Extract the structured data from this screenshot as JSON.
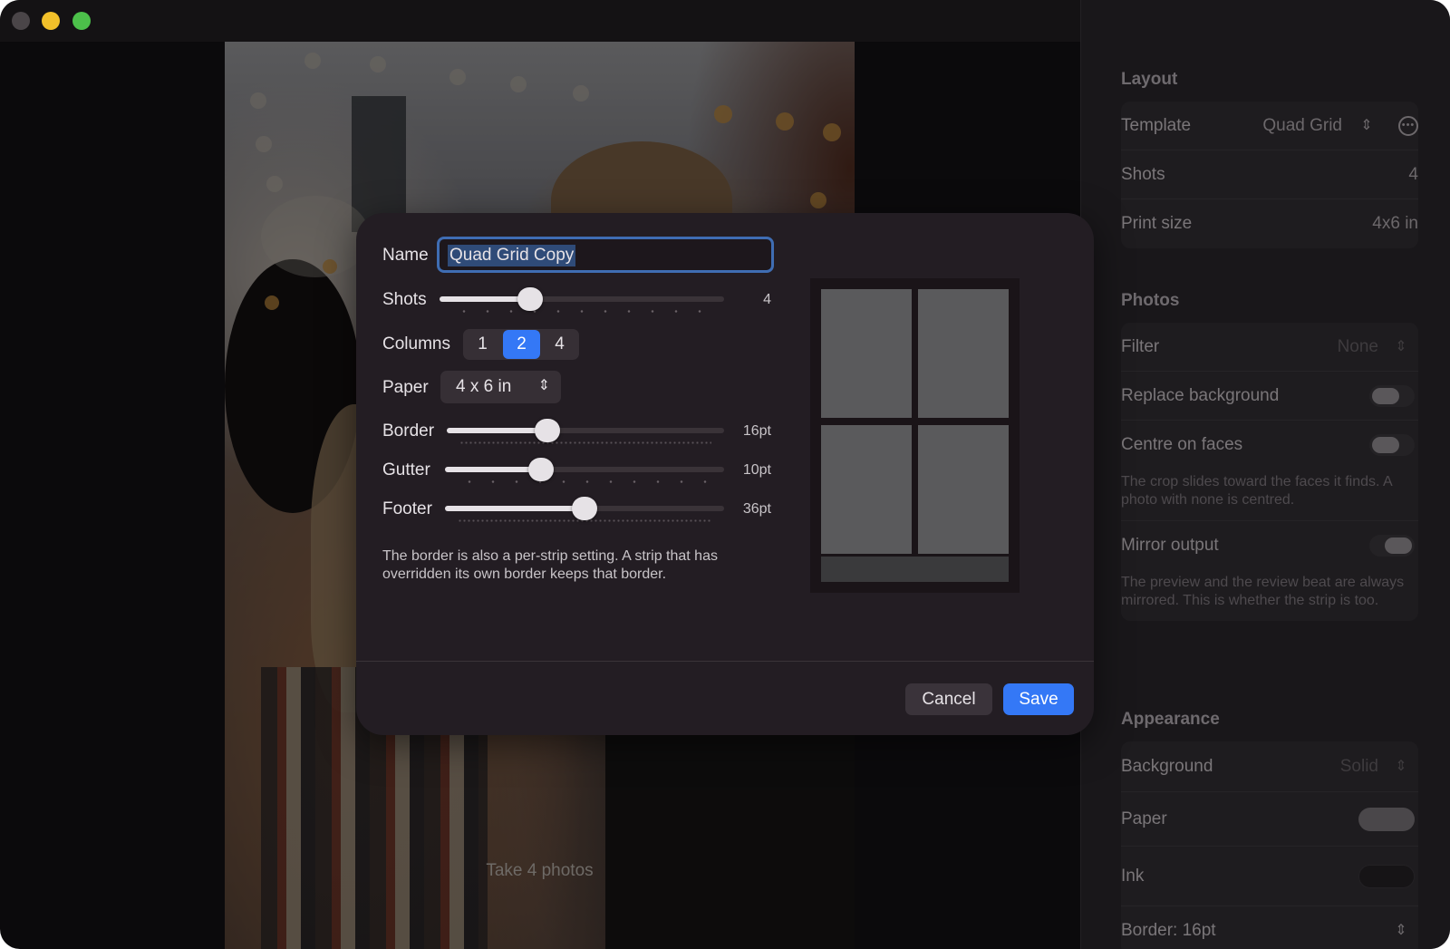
{
  "window": {
    "controls": [
      "close",
      "minimize",
      "maximize"
    ]
  },
  "preview": {
    "prompt": "Take 4 photos"
  },
  "sidebar": {
    "layout": {
      "title": "Layout",
      "template_label": "Template",
      "template_value": "Quad Grid",
      "shots_label": "Shots",
      "shots_value": "4",
      "print_size_label": "Print size",
      "print_size_value": "4x6 in"
    },
    "photos": {
      "title": "Photos",
      "filter_label": "Filter",
      "filter_value": "None",
      "replace_bg_label": "Replace background",
      "replace_bg_on": false,
      "centre_faces_label": "Centre on faces",
      "centre_faces_on": false,
      "centre_faces_note": "The crop slides toward the faces it finds. A photo with none is centred.",
      "mirror_label": "Mirror output",
      "mirror_on": false,
      "mirror_note": "The preview and the review beat are always mirrored. This is whether the strip is too."
    },
    "appearance": {
      "title": "Appearance",
      "background_label": "Background",
      "background_value": "Solid",
      "paper_label": "Paper",
      "paper_color": "#4a474a",
      "ink_label": "Ink",
      "ink_color": "#161416",
      "border_label": "Border: 16pt"
    }
  },
  "dialog": {
    "name_label": "Name",
    "name_value": "Quad Grid Copy",
    "shots_label": "Shots",
    "shots_value": "4",
    "shots_fraction": 0.3,
    "columns_label": "Columns",
    "columns_options": [
      "1",
      "2",
      "4"
    ],
    "columns_selected": "2",
    "paper_label": "Paper",
    "paper_value": "4 x 6 in",
    "border_label": "Border",
    "border_value": "16pt",
    "border_fraction": 0.35,
    "gutter_label": "Gutter",
    "gutter_value": "10pt",
    "gutter_fraction": 0.33,
    "footer_label": "Footer",
    "footer_value": "36pt",
    "footer_fraction": 0.5,
    "help_text": "The border is also a per-strip setting. A strip that has overridden its own border keeps that border.",
    "cancel_label": "Cancel",
    "save_label": "Save",
    "accent_color": "#3478f6"
  }
}
